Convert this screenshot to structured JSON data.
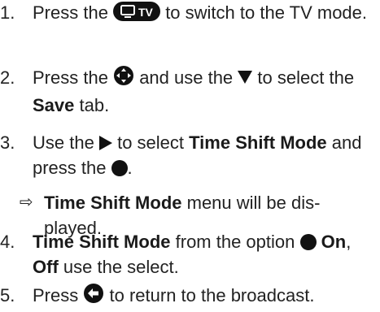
{
  "steps": [
    {
      "num": "1.",
      "t1": "Press the",
      "t2": "to switch to the TV mode.",
      "icon": "tv-button-icon"
    },
    {
      "num": "2.",
      "t1": "Press the",
      "t2": "and use the",
      "t3": "to select the",
      "bold1": "Save",
      "t4": "tab.",
      "icon1": "menu-button-icon",
      "icon2": "down-arrow-icon"
    },
    {
      "num": "3.",
      "t1": "Use the",
      "t2": "to select",
      "bold1": "Time Shift Mode",
      "t3": "and press the",
      "t4": ".",
      "icon1": "right-arrow-icon",
      "icon2": "ok-button-icon"
    },
    {
      "num": "4.",
      "bold1": "Time Shift Mode",
      "t1": "from the option",
      "bold2": "On",
      "t2": ",",
      "bold3": "Off",
      "t3": "use the select.",
      "icon1": "ok-dot-icon"
    },
    {
      "num": "5.",
      "t1": "Press",
      "t2": "to return to the broadcast.",
      "icon1": "back-button-icon"
    }
  ],
  "result": {
    "arrow": "⇨",
    "bold1": "Time Shift Mode",
    "t1": "menu will be dis- played."
  }
}
